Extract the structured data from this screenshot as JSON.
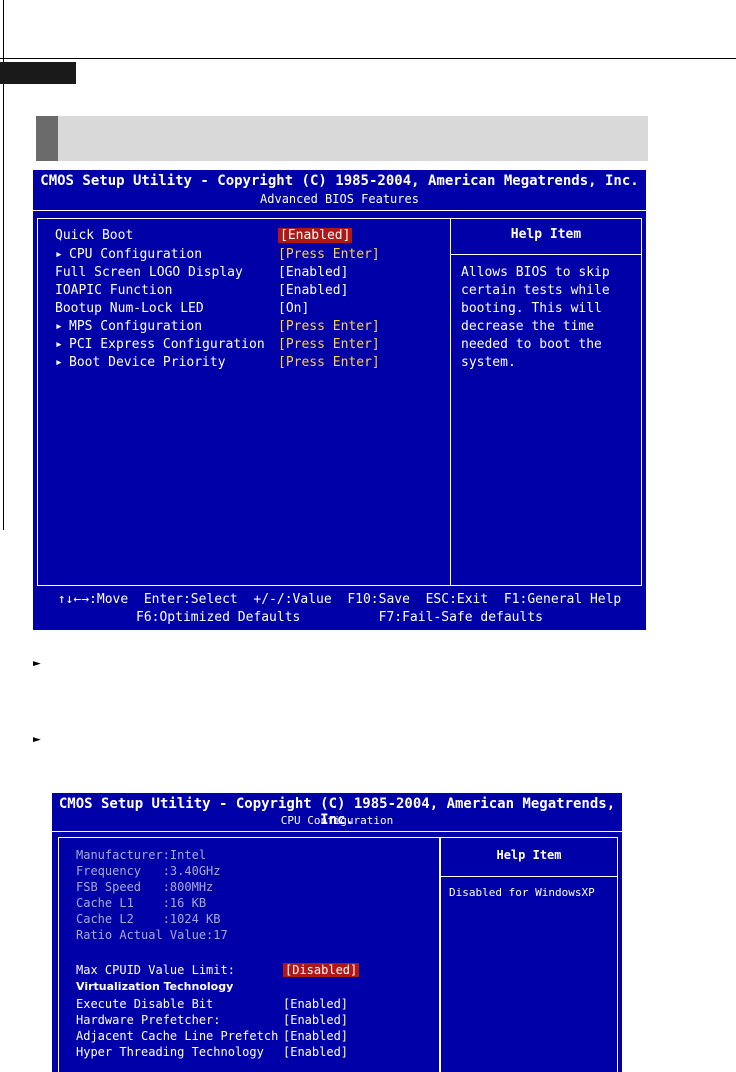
{
  "screen1": {
    "title": "CMOS Setup Utility - Copyright (C) 1985-2004, American Megatrends, Inc.",
    "subtitle": "Advanced BIOS Features",
    "help_title": "Help Item",
    "help_text": "Allows BIOS to skip\ncertain tests while\nbooting. This will\ndecrease the time\nneeded to boot the\nsystem.",
    "items": [
      {
        "label": "Quick Boot",
        "value": "[Enabled]",
        "submenu": false
      },
      {
        "label": "CPU Configuration",
        "value": "[Press Enter]",
        "submenu": true
      },
      {
        "label": "Full Screen LOGO Display",
        "value": "[Enabled]",
        "submenu": false
      },
      {
        "label": "IOAPIC Function",
        "value": "[Enabled]",
        "submenu": false
      },
      {
        "label": "Bootup Num-Lock LED",
        "value": "[On]",
        "submenu": false
      },
      {
        "label": "MPS Configuration",
        "value": "[Press Enter]",
        "submenu": true
      },
      {
        "label": "PCI Express Configuration",
        "value": "[Press Enter]",
        "submenu": true
      },
      {
        "label": "Boot Device Priority",
        "value": "[Press Enter]",
        "submenu": true
      }
    ],
    "footer_line1": "↑↓←→:Move  Enter:Select  +/-/:Value  F10:Save  ESC:Exit  F1:General Help",
    "footer_line2": "F6:Optimized Defaults          F7:Fail-Safe defaults"
  },
  "screen2": {
    "title": "CMOS Setup Utility - Copyright (C) 1985-2004, American Megatrends, Inc.",
    "subtitle": "CPU Configuration",
    "help_title": "Help Item",
    "help_text": "Disabled for WindowsXP",
    "info": [
      {
        "text": "Manufacturer:Intel"
      },
      {
        "text": "Frequency   :3.40GHz"
      },
      {
        "text": "FSB Speed   :800MHz"
      },
      {
        "text": "Cache L1    :16 KB"
      },
      {
        "text": "Cache L2    :1024 KB"
      },
      {
        "text": "Ratio Actual Value:17"
      }
    ],
    "items": [
      {
        "label": "Max CPUID Value Limit:",
        "value": "[Disabled]"
      },
      {
        "label": "Execute Disable Bit",
        "value": "[Enabled]"
      },
      {
        "label": "Hardware Prefetcher:",
        "value": "[Enabled]"
      },
      {
        "label": "Adjacent Cache Line Prefetch",
        "value": "[Enabled]"
      },
      {
        "label": "Hyper Threading Technology",
        "value": "[Enabled]"
      }
    ],
    "vt_label": "Virtualization Technology"
  },
  "bullets": [
    "►",
    "►"
  ]
}
